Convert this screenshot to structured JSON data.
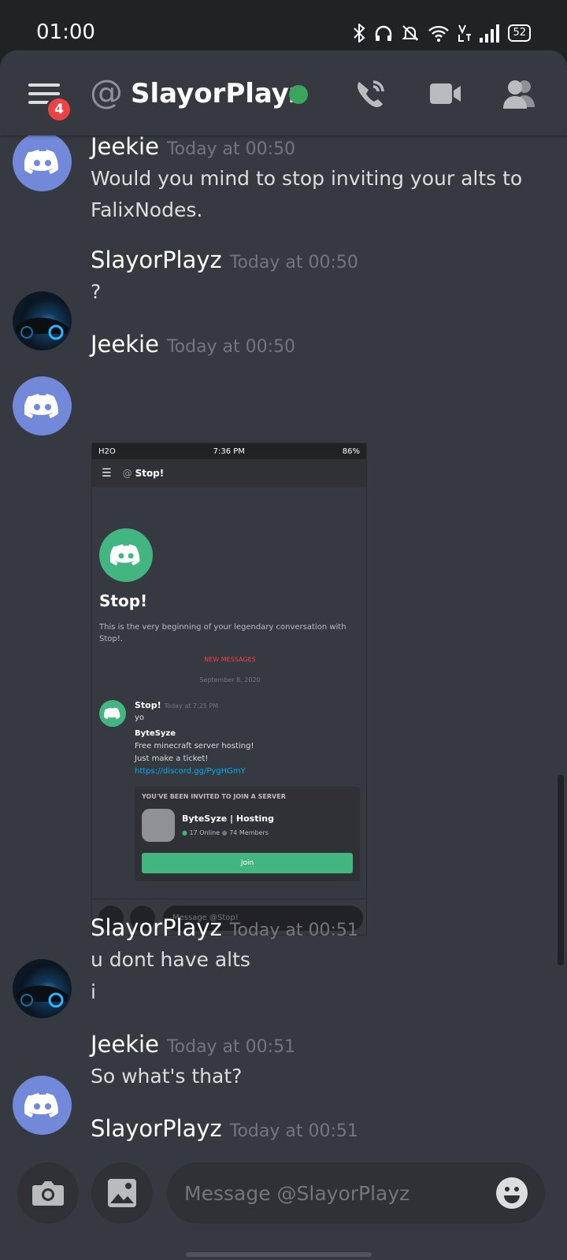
{
  "status_bar": {
    "time": "01:00",
    "battery": "52"
  },
  "header": {
    "title": "SlayorPlayz",
    "notification_count": "4"
  },
  "messages": [
    {
      "author": "Jeekie",
      "timestamp": "Today at 00:50",
      "lines": [
        "Would you mind to stop inviting your alts to",
        "FalixNodes."
      ]
    },
    {
      "author": "SlayorPlayz",
      "timestamp": "Today at 00:50",
      "lines": [
        "?"
      ]
    },
    {
      "author": "Jeekie",
      "timestamp": "Today at 00:50",
      "lines": []
    },
    {
      "author": "SlayorPlayz",
      "timestamp": "Today at 00:51",
      "lines": [
        "u dont have alts",
        "i"
      ]
    },
    {
      "author": "Jeekie",
      "timestamp": "Today at 00:51",
      "lines": [
        "So what's that?"
      ]
    },
    {
      "author": "SlayorPlayz",
      "timestamp": "Today at 00:51",
      "lines": []
    }
  ],
  "attachment": {
    "status": {
      "carrier": "H2O",
      "time": "7:36 PM",
      "battery": "86%"
    },
    "header_title": "Stop!",
    "welcome_title": "Stop!",
    "welcome_text": "This is the very beginning of your legendary conversation with Stop!.",
    "new_messages": "NEW MESSAGES",
    "date_divider": "September 8, 2020",
    "message": {
      "author": "Stop!",
      "timestamp": "Today at 7:25 PM",
      "lines": [
        "yo",
        "ByteSyze",
        "Free minecraft server hosting!",
        "Just make a ticket!",
        "https://discord.gg/PygHGmY"
      ]
    },
    "invite": {
      "heading": "YOU'VE BEEN INVITED TO JOIN A SERVER",
      "server_name": "ByteSyze | Hosting",
      "online": "17 Online",
      "members": "74 Members",
      "join_label": "Join"
    },
    "input_placeholder": "Message @Stop!"
  },
  "composer": {
    "placeholder": "Message @SlayorPlayz"
  },
  "colors": {
    "background": "#36393f",
    "blurple": "#7289da",
    "online": "#3ba55d",
    "badge": "#ed4245",
    "join": "#43b581"
  }
}
